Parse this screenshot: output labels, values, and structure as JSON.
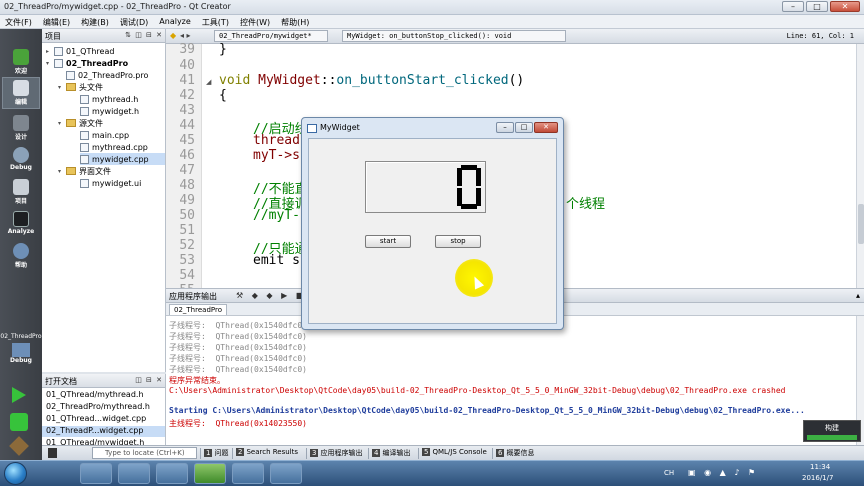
{
  "window": {
    "title": "02_ThreadPro/mywidget.cpp - 02_ThreadPro - Qt Creator"
  },
  "menu": [
    "文件(F)",
    "编辑(E)",
    "构建(B)",
    "调试(D)",
    "Analyze",
    "工具(T)",
    "控件(W)",
    "帮助(H)"
  ],
  "modes": [
    {
      "label": "欢迎",
      "icon": "welcome-icon"
    },
    {
      "label": "编辑",
      "icon": "edit-icon"
    },
    {
      "label": "设计",
      "icon": "design-icon"
    },
    {
      "label": "Debug",
      "icon": "debug-icon"
    },
    {
      "label": "项目",
      "icon": "projects-icon"
    },
    {
      "label": "Analyze",
      "icon": "analyze-icon"
    },
    {
      "label": "帮助",
      "icon": "help-icon"
    }
  ],
  "target": {
    "project": "02_ThreadPro",
    "config": "Debug"
  },
  "project_pane": {
    "title": "项目",
    "tree": [
      "01_QThread",
      "02_ThreadPro",
      "02_ThreadPro.pro",
      "头文件",
      "mythread.h",
      "mywidget.h",
      "源文件",
      "main.cpp",
      "mythread.cpp",
      "mywidget.cpp",
      "界面文件",
      "mywidget.ui"
    ]
  },
  "open_docs": {
    "title": "打开文档",
    "files": [
      "01_QThread/mythread.h",
      "02_ThreadPro/mythread.h",
      "01_QThread...widget.cpp",
      "02_ThreadP...widget.cpp",
      "01_QThread/mywidget.h"
    ]
  },
  "editor_bar": {
    "file": "02_ThreadPro/mywidget*",
    "function": "MyWidget: on_buttonStop_clicked(): void",
    "position": "Line: 61, Col: 1"
  },
  "code": {
    "lines": [
      "39",
      "40",
      "41",
      "42",
      "43",
      "44",
      "45",
      "46",
      "47",
      "48",
      "49",
      "50",
      "51",
      "52",
      "53",
      "54",
      "55"
    ],
    "l39": "}",
    "l41_kw": "void",
    "l41_cls": "MyWidget",
    "l41_fn": "on_buttonStart_clicked",
    "l41_rest": "()",
    "l42": "{",
    "l44": "//启动线",
    "l45": "thread",
    "l46": "myT->s",
    "l48": "//不能直",
    "l49a": "//直接调",
    "l49b": "个线程",
    "l50": "//myT-",
    "l52": "//只能通",
    "l53": "emit s"
  },
  "output": {
    "header": "应用程序输出",
    "tab": "02_ThreadPro",
    "lines": [
      {
        "label": "子线程号:",
        "value": "QThread(0x1540dfc0)"
      },
      {
        "label": "子线程号:",
        "value": "QThread(0x1540dfc0)"
      },
      {
        "label": "子线程号:",
        "value": "QThread(0x1540dfc0)"
      },
      {
        "label": "子线程号:",
        "value": "QThread(0x1540dfc0)"
      },
      {
        "label": "子线程号:",
        "value": "QThread(0x1540dfc0)"
      }
    ],
    "abnormal": "程序异常结束。",
    "crash": "C:\\Users\\Administrator\\Desktop\\QtCode\\day05\\build-02_ThreadPro-Desktop_Qt_5_5_0_MinGW_32bit-Debug\\debug\\02_ThreadPro.exe crashed",
    "starting": "Starting C:\\Users\\Administrator\\Desktop\\QtCode\\day05\\build-02_ThreadPro-Desktop_Qt_5_5_0_MinGW_32bit-Debug\\debug\\02_ThreadPro.exe...",
    "main_label": "主线程号:",
    "main_value": "QThread(0x14023550)"
  },
  "statusbar": {
    "locate_placeholder": "Type to locate (Ctrl+K)",
    "panes": [
      {
        "num": "1",
        "label": "问题"
      },
      {
        "num": "2",
        "label": "Search Results"
      },
      {
        "num": "3",
        "label": "应用程序输出"
      },
      {
        "num": "4",
        "label": "编译输出"
      },
      {
        "num": "5",
        "label": "QML/JS Console"
      },
      {
        "num": "6",
        "label": "概要信息"
      }
    ],
    "build_label": "构建",
    "build_progress": 1.0
  },
  "dialog": {
    "title": "MyWidget",
    "lcd_value": "0",
    "start_label": "start",
    "stop_label": "stop"
  },
  "tray": {
    "ime": "CH",
    "time": "11:34",
    "date": "2016/1/7"
  }
}
